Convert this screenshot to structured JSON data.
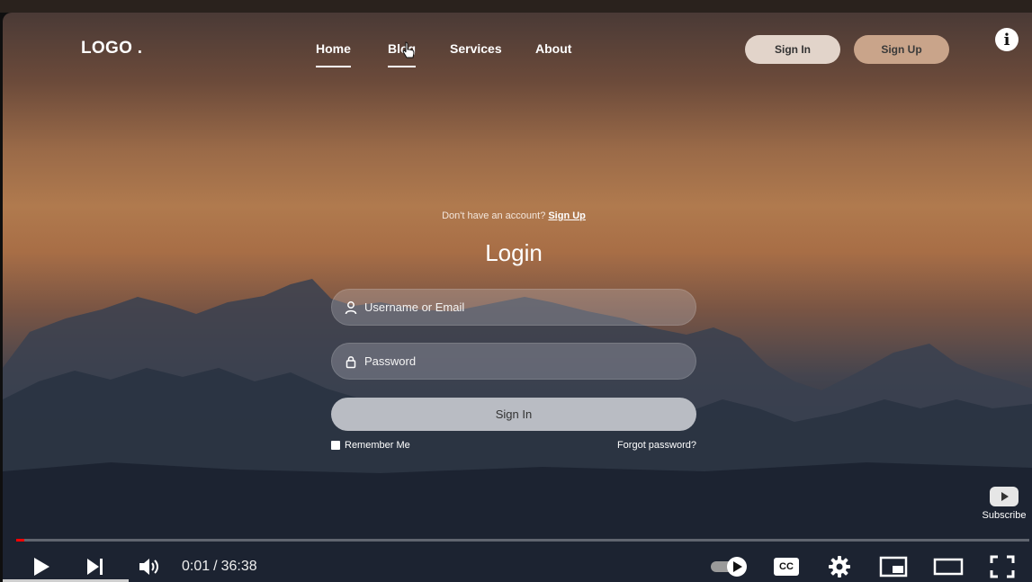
{
  "nav": {
    "logo": "LOGO .",
    "links": [
      "Home",
      "Blog",
      "Services",
      "About"
    ],
    "sign_in": "Sign In",
    "sign_up": "Sign Up",
    "info": "i"
  },
  "login": {
    "no_account": "Don't have an account?",
    "sign_up_link": "Sign Up",
    "title": "Login",
    "username_placeholder": "Username or Email",
    "password_placeholder": "Password",
    "submit": "Sign In",
    "remember": "Remember Me",
    "forgot": "Forgot password?"
  },
  "subscribe": "Subscribe",
  "player": {
    "current_time": "0:01",
    "separator": "/",
    "duration": "36:38",
    "progress_percent": 0.8,
    "captions": "CC",
    "icons": [
      "play-icon",
      "next-icon",
      "volume-icon",
      "autoplay-toggle-icon",
      "cc-icon",
      "settings-icon",
      "miniplayer-icon",
      "theater-icon",
      "fullscreen-icon"
    ]
  },
  "colors": {
    "progress": "#ff0000",
    "sky_top": "#4a3a36",
    "sky_glow": "#b07a4e",
    "mountain_dark": "#1c2532"
  }
}
